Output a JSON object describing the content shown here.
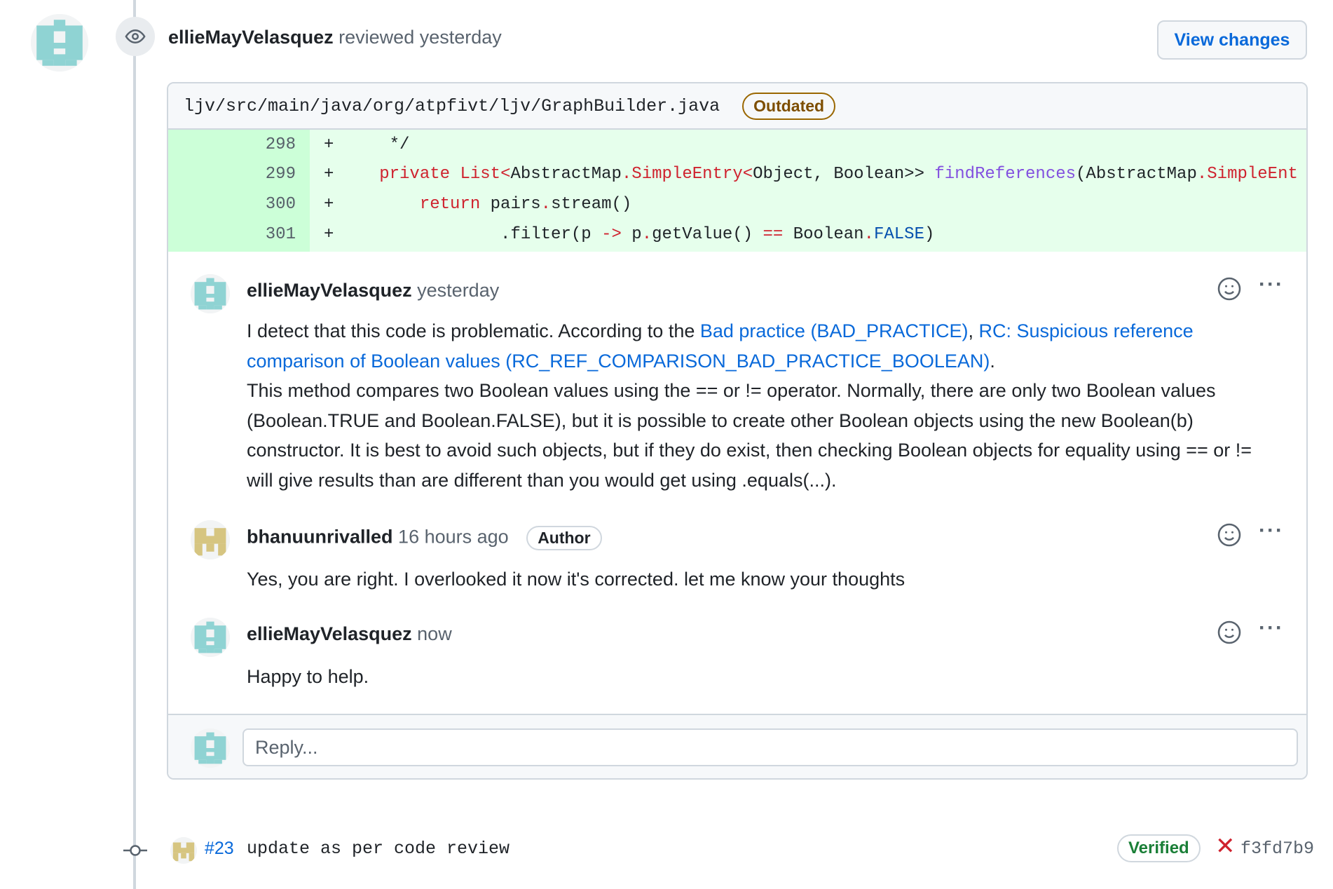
{
  "review": {
    "user": "ellieMayVelasquez",
    "action": "reviewed",
    "time": "yesterday",
    "view_changes_label": "View changes"
  },
  "file": {
    "path": "ljv/src/main/java/org/atpfivt/ljv/GraphBuilder.java",
    "badge": "Outdated"
  },
  "diff": [
    {
      "line": "298",
      "sign": "+",
      "code": "    */"
    },
    {
      "line": "299",
      "sign": "+",
      "code": "   private List<AbstractMap.SimpleEntry<Object, Boolean>> findReferences(AbstractMap.SimpleEnt"
    },
    {
      "line": "300",
      "sign": "+",
      "code": "       return pairs.stream()"
    },
    {
      "line": "301",
      "sign": "+",
      "code": "               .filter(p -> p.getValue() == Boolean.FALSE)"
    }
  ],
  "comments": [
    {
      "user": "ellieMayVelasquez",
      "time": "yesterday",
      "intro": "I detect that this code is problematic. According to the ",
      "link1": "Bad practice (BAD_PRACTICE)",
      "sep": ", ",
      "link2": "RC: Suspicious reference comparison of Boolean values (RC_REF_COMPARISON_BAD_PRACTICE_BOOLEAN)",
      "end": ".",
      "body": "This method compares two Boolean values using the == or != operator. Normally, there are only two Boolean values (Boolean.TRUE and Boolean.FALSE), but it is possible to create other Boolean objects using the new Boolean(b) constructor. It is best to avoid such objects, but if they do exist, then checking Boolean objects for equality using == or != will give results than are different than you would get using .equals(...)."
    },
    {
      "user": "bhanuunrivalled",
      "time": "16 hours ago",
      "badge": "Author",
      "body": "Yes, you are right. I overlooked it now it's corrected. let me know your thoughts"
    },
    {
      "user": "ellieMayVelasquez",
      "time": "now",
      "body": "Happy to help."
    }
  ],
  "more_label": "···",
  "reply": {
    "placeholder": "Reply..."
  },
  "commit": {
    "number": "#23",
    "message": "update as per code review",
    "verified": "Verified",
    "status_mark": "✕",
    "sha": "f3fd7b9"
  },
  "icons": {
    "review": "eye-icon",
    "reaction": "smiley-icon",
    "more": "kebab-horizontal-icon",
    "commit": "git-commit-icon",
    "failed": "x-icon"
  },
  "colors": {
    "link": "#0969da",
    "added_bg": "#e6ffec",
    "added_gutter": "#ccffd8",
    "outdated": "#9a6700",
    "verified": "#1a7f37",
    "failed": "#cf222e",
    "avatar_teal": "#8fd3d3",
    "avatar_gold": "#d6c581"
  }
}
